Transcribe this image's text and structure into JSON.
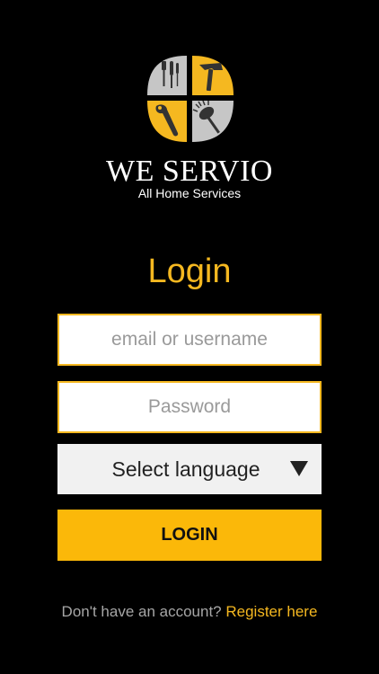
{
  "brand": {
    "name": "WE SERVIO",
    "tagline": "All Home Services",
    "logo_icons": [
      "screwdriver-icon",
      "hammer-icon",
      "wrench-icon",
      "brush-icon"
    ],
    "colors": {
      "accent": "#f5b820",
      "logo_gray": "#c6c6c6",
      "tool_dark": "#333333"
    }
  },
  "login": {
    "title": "Login",
    "email_placeholder": "email or username",
    "password_placeholder": "Password",
    "language_label": "Select language",
    "submit_label": "LOGIN",
    "register_prompt": "Don't have an account?",
    "register_link": "Register here"
  },
  "colors": {
    "background": "#000000",
    "button": "#fbb809",
    "field_border": "#f5b820",
    "select_background": "#f1f1f1"
  }
}
